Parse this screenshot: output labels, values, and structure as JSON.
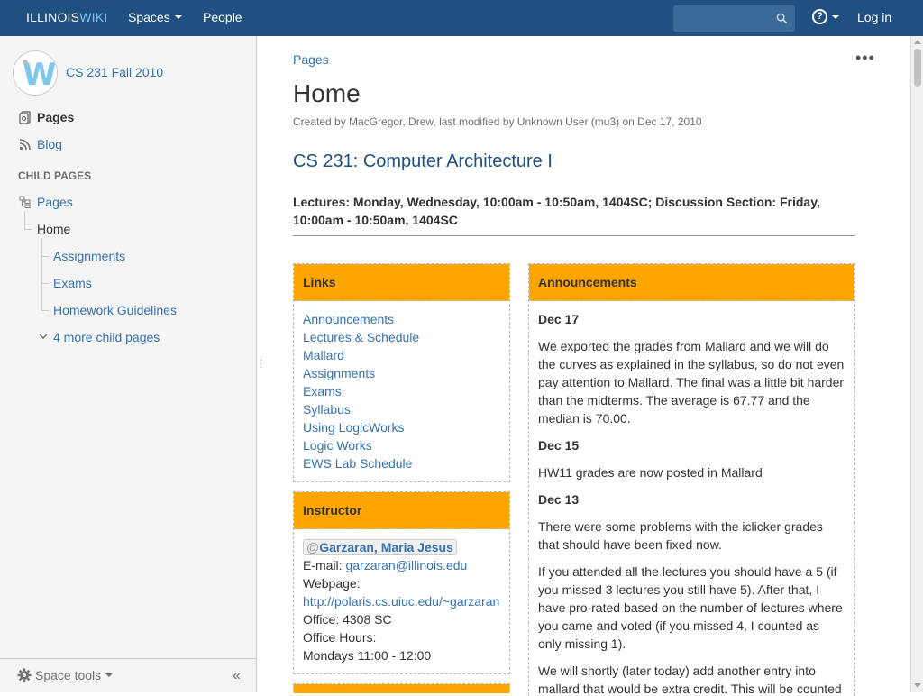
{
  "topbar": {
    "logo_prefix": "ILLINOIS",
    "logo_suffix": "WIKI",
    "spaces_label": "Spaces",
    "people_label": "People",
    "search_placeholder": "",
    "login_label": "Log in",
    "help_glyph": "?"
  },
  "sidebar": {
    "space_name": "CS 231 Fall 2010",
    "pages_label": "Pages",
    "blog_label": "Blog",
    "child_pages_header": "CHILD PAGES",
    "tree": {
      "root": "Pages",
      "current": "Home",
      "children": [
        "Assignments",
        "Exams",
        "Homework Guidelines"
      ],
      "more": "4 more child pages"
    },
    "space_tools_label": "Space tools"
  },
  "main": {
    "breadcrumb": "Pages",
    "title": "Home",
    "byline": "Created by MacGregor, Drew, last modified by Unknown User (mu3) on Dec 17, 2010",
    "heading": "CS 231: Computer Architecture I",
    "lectures": "Lectures: Monday, Wednesday, 10:00am - 10:50am, 1404SC; Discussion Section: Friday, 10:00am - 10:50am, 1404SC",
    "links_panel": {
      "title": "Links",
      "items": [
        "Announcements",
        "Lectures & Schedule",
        "Mallard",
        "Assignments",
        "Exams",
        "Syllabus",
        "Using LogicWorks",
        "Logic Works",
        "EWS Lab Schedule"
      ]
    },
    "instructor_panel": {
      "title": "Instructor",
      "mention_at": "@",
      "name": "Garzaran, Maria Jesus",
      "email_label": "E-mail: ",
      "email": "garzaran@illinois.edu",
      "webpage_label": "Webpage:",
      "webpage": "http://polaris.cs.uiuc.edu/~garzaran",
      "office": "Office: 4308 SC",
      "hours_label": "Office Hours:",
      "hours": "Mondays 11:00 - 12:00"
    },
    "announcements_panel": {
      "title": "Announcements",
      "entries": [
        {
          "date": "Dec 17",
          "text": "We exported the grades from Mallard and we will do the curves as explained in the syllabus,  so do not even pay attention to Mallard. The final was a little bit harder than the midterms. The average is 67.77 and the median is 70.00."
        },
        {
          "date": "Dec 15",
          "text": "HW11 grades are now posted in Mallard"
        },
        {
          "date": "Dec 13",
          "text": "There were some problems with the iclicker grades that should have been fixed now."
        }
      ],
      "extra_1": "If you attended all the lectures you should have a 5 (if you missed 3 lectures you still have 5). After that, I have pro-rated based on the number of lectures where you came and voted (if you missed 4, I counted as only missing 1).",
      "extra_2": "We will shortly (later today) add another entry into mallard that would be extra credit. This will be counted"
    }
  }
}
